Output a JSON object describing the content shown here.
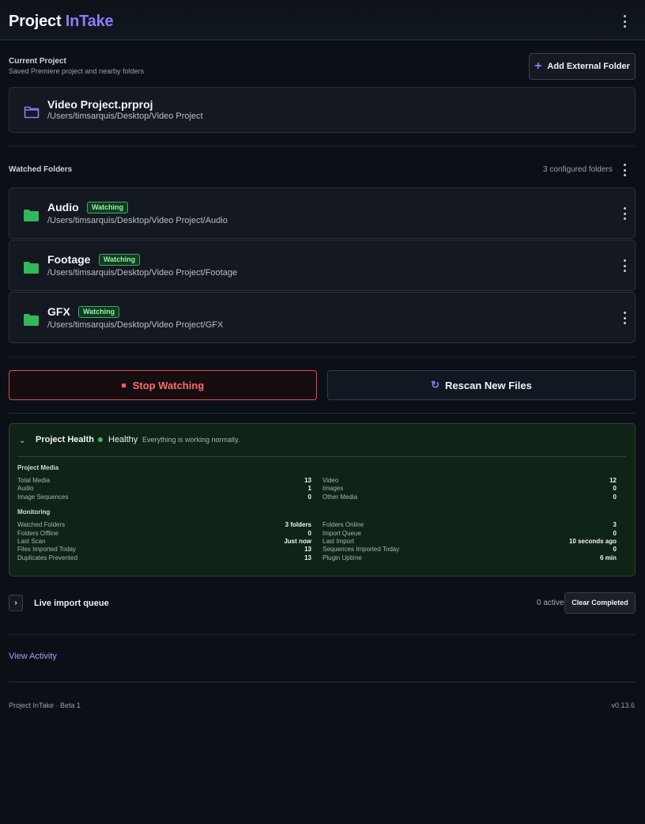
{
  "header": {
    "title_main": "Project",
    "title_accent": "InTake"
  },
  "current_project": {
    "heading": "Current Project",
    "subtitle": "Saved Premiere project and nearby folders",
    "add_button": "Add External Folder",
    "file_name": "Video Project.prproj",
    "path": "/Users/timsarquis/Desktop/Video Project"
  },
  "watched": {
    "heading": "Watched Folders",
    "count_label": "3 configured folders",
    "folders": [
      {
        "name": "Audio",
        "status": "Watching",
        "path": "/Users/timsarquis/Desktop/Video Project/Audio"
      },
      {
        "name": "Footage",
        "status": "Watching",
        "path": "/Users/timsarquis/Desktop/Video Project/Footage"
      },
      {
        "name": "GFX",
        "status": "Watching",
        "path": "/Users/timsarquis/Desktop/Video Project/GFX"
      }
    ]
  },
  "actions": {
    "stop": "Stop Watching",
    "rescan": "Rescan New Files"
  },
  "health": {
    "title": "Project Health",
    "status": "Healthy",
    "message": "Everything is working normally.",
    "media_heading": "Project Media",
    "media": [
      {
        "label": "Total Media",
        "value": "13"
      },
      {
        "label": "Video",
        "value": "12"
      },
      {
        "label": "Audio",
        "value": "1"
      },
      {
        "label": "Images",
        "value": "0"
      },
      {
        "label": "Image Sequences",
        "value": "0"
      },
      {
        "label": "Other Media",
        "value": "0"
      }
    ],
    "monitoring_heading": "Monitoring",
    "monitoring": [
      {
        "label": "Watched Folders",
        "value": "3 folders"
      },
      {
        "label": "Folders Online",
        "value": "3"
      },
      {
        "label": "Folders Offline",
        "value": "0"
      },
      {
        "label": "Import Queue",
        "value": "0"
      },
      {
        "label": "Last Scan",
        "value": "Just now"
      },
      {
        "label": "Last Import",
        "value": "10 seconds ago"
      },
      {
        "label": "Files Imported Today",
        "value": "13"
      },
      {
        "label": "Sequences Imported Today",
        "value": "0"
      },
      {
        "label": "Duplicates Prevented",
        "value": "13"
      },
      {
        "label": "Plugin Uptime",
        "value": "6 min"
      }
    ]
  },
  "queue": {
    "title": "Live import queue",
    "count": "0 active",
    "clear_button": "Clear Completed"
  },
  "activity_link": "View Activity",
  "footer": {
    "left": "Project InTake · Beta 1",
    "right": "v0.13.6"
  },
  "colors": {
    "accent": "#8b7cf6",
    "success": "#31c25a",
    "danger": "#e5484d"
  },
  "icons": {
    "project": "folder-outline-icon",
    "watched_folder": "folder-filled-icon",
    "more": "kebab-menu-icon",
    "add": "plus-icon",
    "stop": "stop-icon",
    "rescan": "refresh-icon",
    "collapse": "chevron-down-icon",
    "expand": "chevron-right-icon"
  }
}
